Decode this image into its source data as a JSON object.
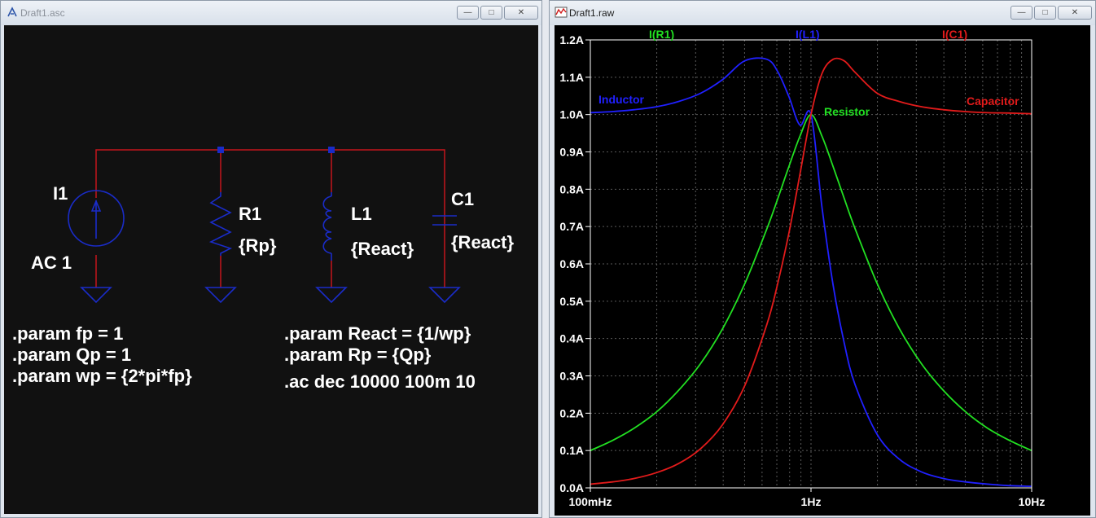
{
  "schematic_window": {
    "title": "Draft1.asc",
    "icon": "schematic-icon",
    "components": {
      "i1": {
        "ref": "I1",
        "value": "AC 1"
      },
      "r1": {
        "ref": "R1",
        "value": "{Rp}"
      },
      "l1": {
        "ref": "L1",
        "value": "{React}"
      },
      "c1": {
        "ref": "C1",
        "value": "{React}"
      }
    },
    "directives_left": [
      ".param fp = 1",
      ".param Qp = 1",
      ".param wp = {2*pi*fp}"
    ],
    "directives_right": [
      ".param React = {1/wp}",
      ".param Rp = {Qp}",
      ".ac dec 10000 100m 10"
    ]
  },
  "waveform_window": {
    "title": "Draft1.raw",
    "icon": "waveform-icon",
    "trace_labels": [
      {
        "text": "I(R1)",
        "color": "#22e022"
      },
      {
        "text": "I(L1)",
        "color": "#2020ff"
      },
      {
        "text": "I(C1)",
        "color": "#e21b1b"
      }
    ],
    "annotations": {
      "inductor": "Inductor",
      "resistor": "Resistor",
      "capacitor": "Capacitor"
    }
  },
  "colors": {
    "wire": "#c4161c",
    "component": "#1a2cc8",
    "junction": "#1a2cc8",
    "text": "#ffffff",
    "grid": "#5a5a5a",
    "plot_bg": "#000000",
    "axis_text": "#ffffff"
  },
  "chart_data": {
    "type": "line",
    "xscale": "log",
    "xlim": [
      0.1,
      10
    ],
    "ylim": [
      0.0,
      1.2
    ],
    "x_ticks": [
      "100mHz",
      "1Hz",
      "10Hz"
    ],
    "y_ticks": [
      "0.0A",
      "0.1A",
      "0.2A",
      "0.3A",
      "0.4A",
      "0.5A",
      "0.6A",
      "0.7A",
      "0.8A",
      "0.9A",
      "1.0A",
      "1.1A",
      "1.2A"
    ],
    "grid": true,
    "series": [
      {
        "name": "I(R1)",
        "color": "#22e022",
        "x": [
          0.1,
          0.126,
          0.158,
          0.2,
          0.251,
          0.316,
          0.398,
          0.501,
          0.631,
          0.708,
          0.794,
          0.891,
          1.0,
          1.122,
          1.259,
          1.413,
          1.585,
          1.995,
          2.512,
          3.162,
          3.981,
          5.012,
          6.31,
          7.943,
          10.0
        ],
        "values": [
          0.1,
          0.127,
          0.16,
          0.204,
          0.261,
          0.333,
          0.427,
          0.547,
          0.694,
          0.776,
          0.861,
          0.942,
          1.0,
          0.942,
          0.861,
          0.776,
          0.694,
          0.547,
          0.427,
          0.333,
          0.261,
          0.204,
          0.16,
          0.127,
          0.1
        ]
      },
      {
        "name": "I(L1)",
        "color": "#2020ff",
        "x": [
          0.1,
          0.126,
          0.158,
          0.2,
          0.251,
          0.316,
          0.398,
          0.501,
          0.631,
          0.708,
          0.794,
          0.891,
          1.0,
          1.122,
          1.259,
          1.413,
          1.585,
          1.995,
          2.512,
          3.162,
          3.981,
          5.012,
          6.31,
          7.943,
          10.0
        ],
        "values": [
          1.005,
          1.008,
          1.013,
          1.021,
          1.035,
          1.057,
          1.094,
          1.144,
          1.148,
          1.114,
          1.048,
          0.972,
          1.0,
          0.751,
          0.544,
          0.389,
          0.276,
          0.143,
          0.077,
          0.043,
          0.025,
          0.016,
          0.01,
          0.006,
          0.004
        ]
      },
      {
        "name": "I(C1)",
        "color": "#e21b1b",
        "x": [
          0.1,
          0.126,
          0.158,
          0.2,
          0.251,
          0.316,
          0.398,
          0.501,
          0.631,
          0.708,
          0.794,
          0.891,
          1.0,
          1.122,
          1.259,
          1.413,
          1.585,
          1.995,
          2.512,
          3.162,
          3.981,
          5.012,
          6.31,
          7.943,
          10.0
        ],
        "values": [
          0.01,
          0.016,
          0.025,
          0.041,
          0.065,
          0.105,
          0.17,
          0.274,
          0.438,
          0.55,
          0.683,
          0.84,
          1.0,
          1.11,
          1.148,
          1.144,
          1.113,
          1.057,
          1.035,
          1.021,
          1.013,
          1.008,
          1.005,
          1.004,
          1.002
        ]
      }
    ]
  }
}
